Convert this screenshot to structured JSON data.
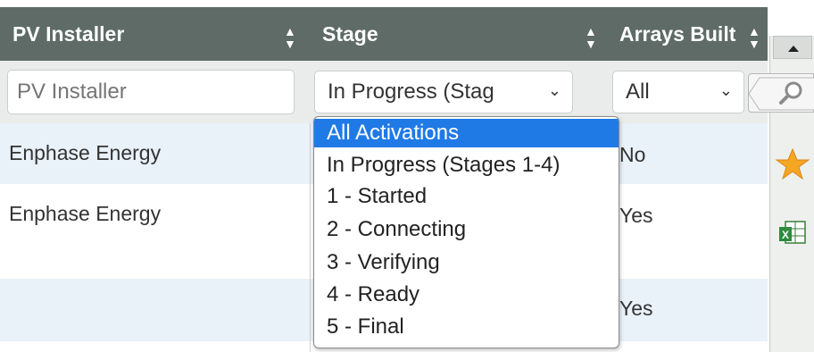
{
  "table": {
    "columns": [
      {
        "label": "PV Installer"
      },
      {
        "label": "Stage"
      },
      {
        "label": "Arrays Built"
      }
    ],
    "filters": {
      "installer_placeholder": "PV Installer",
      "stage_selected": "In Progress (Stag",
      "arrays_selected": "All"
    },
    "rows": [
      {
        "installer": "Enphase Energy",
        "arrays_built": "No"
      },
      {
        "installer": "Enphase Energy",
        "arrays_built": "Yes"
      },
      {
        "installer": "",
        "arrays_built": "Yes"
      }
    ]
  },
  "stage_dropdown": {
    "options": [
      "All Activations",
      "In Progress (Stages 1-4)",
      "1 - Started",
      "2 - Connecting",
      "3 - Verifying",
      "4 - Ready",
      "5 - Final"
    ],
    "highlighted": "All Activations"
  },
  "toolbar": {
    "icons": [
      "scroll-up-arrow-icon",
      "search-icon",
      "star-icon",
      "excel-export-icon"
    ]
  },
  "colors": {
    "header_bg": "#5e6b66",
    "filter_bg": "#e9ecea",
    "alt_row_bg": "#e9f1f9",
    "highlight": "#1f7ae6",
    "star": "#f5a623"
  }
}
